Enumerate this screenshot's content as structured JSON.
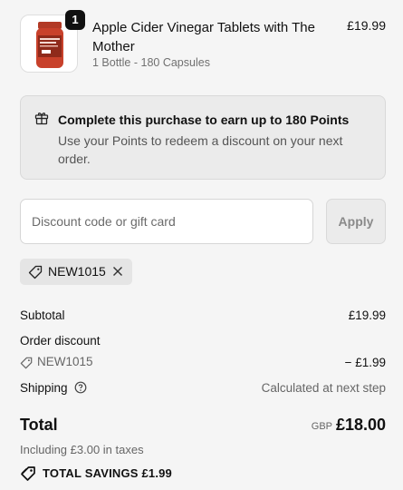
{
  "product": {
    "quantity": "1",
    "title": "Apple Cider Vinegar Tablets with The Mother",
    "variant": "1 Bottle - 180 Capsules",
    "price": "£19.99",
    "thumbnail_icon": "supplement-bottle-image"
  },
  "points": {
    "icon": "gift-icon",
    "title": "Complete this purchase to earn up to 180 Points",
    "description": "Use your Points to redeem a discount on your next order."
  },
  "discount": {
    "placeholder": "Discount code or gift card",
    "value": "",
    "apply_label": "Apply",
    "applied_code": "NEW1015"
  },
  "summary": {
    "subtotal_label": "Subtotal",
    "subtotal_value": "£19.99",
    "order_discount_label": "Order discount",
    "discount_code": "NEW1015",
    "discount_value": "− £1.99",
    "shipping_label": "Shipping",
    "shipping_value": "Calculated at next step",
    "total_label": "Total",
    "currency": "GBP",
    "total_value": "£18.00",
    "tax_note": "Including £3.00 in taxes",
    "savings_text": "TOTAL SAVINGS  £1.99"
  },
  "colors": {
    "background": "#f5f5f5",
    "panel": "#ebebeb",
    "text": "#111111",
    "muted": "#666666",
    "badge": "#111111",
    "bottle_red": "#c8412b"
  }
}
